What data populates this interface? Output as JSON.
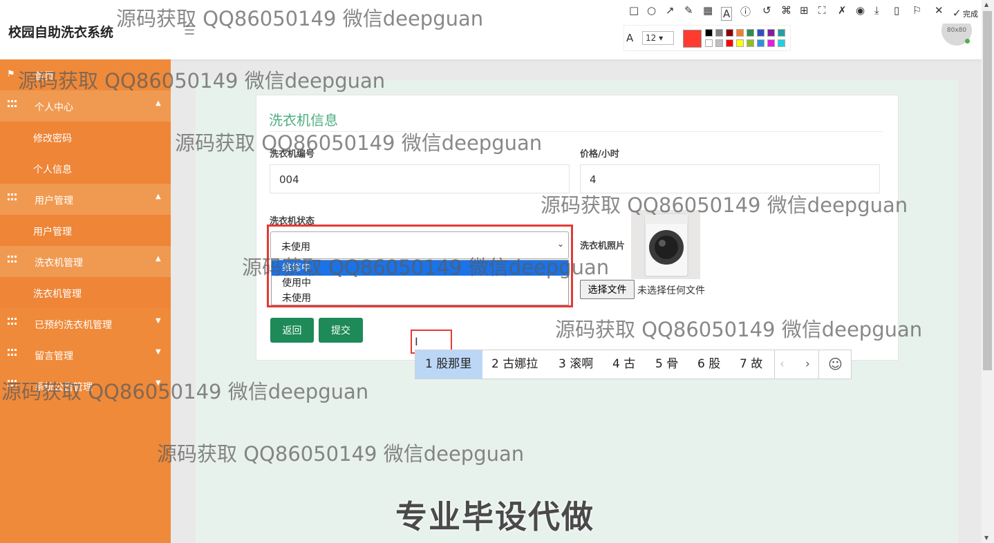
{
  "header": {
    "title": "校园自助洗衣系统",
    "menu_icon": "☰",
    "avatar_text": "80x80"
  },
  "sidebar": {
    "home": "首页",
    "items": [
      {
        "label": "个人中心",
        "type": "group",
        "caret": "▲"
      },
      {
        "label": "修改密码",
        "type": "sub"
      },
      {
        "label": "个人信息",
        "type": "sub"
      },
      {
        "label": "用户管理",
        "type": "group",
        "caret": "▲"
      },
      {
        "label": "用户管理",
        "type": "sub"
      },
      {
        "label": "洗衣机管理",
        "type": "group",
        "caret": "▲"
      },
      {
        "label": "洗衣机管理",
        "type": "sub"
      },
      {
        "label": "已预约洗衣机管理",
        "type": "group",
        "caret": "▼"
      },
      {
        "label": "留言管理",
        "type": "group",
        "caret": "▼"
      },
      {
        "label": "系统公告管理",
        "type": "group",
        "caret": "▼"
      }
    ]
  },
  "form": {
    "title": "洗衣机信息",
    "number_label": "洗衣机编号",
    "number_value": "004",
    "price_label": "价格/小时",
    "price_value": "4",
    "status_label": "洗衣机状态",
    "status_selected": "未使用",
    "status_options": [
      "维修中",
      "使用中",
      "未使用"
    ],
    "photo_label": "洗衣机照片",
    "file_button": "选择文件",
    "file_status": "未选择任何文件",
    "back_button": "返回",
    "submit_button": "提交"
  },
  "ime": {
    "candidates": [
      "1 股那里",
      "2 古娜拉",
      "3 滚啊",
      "4 古",
      "5 骨",
      "6 股",
      "7 故"
    ],
    "prev": "‹",
    "next": "›",
    "emoji": "☺"
  },
  "annotation_toolbar": {
    "done_label": "完成",
    "font_size": "12",
    "current_color": "#ff3b30",
    "palette": [
      "#000000",
      "#808080",
      "#8b0000",
      "#f08030",
      "#2e8b57",
      "#3050c0",
      "#8020a0",
      "#20a0a0",
      "#ffffff",
      "#c0c0c0",
      "#ff0000",
      "#ffff00",
      "#90c020",
      "#3090e0",
      "#e020e0",
      "#20d0e0"
    ]
  },
  "watermarks": {
    "text": "源码获取 QQ86050149 微信deepguan",
    "banner": "专业毕设代做"
  },
  "colors": {
    "sidebar": "#ef8a3a",
    "accent_green": "#1d8a57",
    "title_green": "#4cae7f"
  }
}
